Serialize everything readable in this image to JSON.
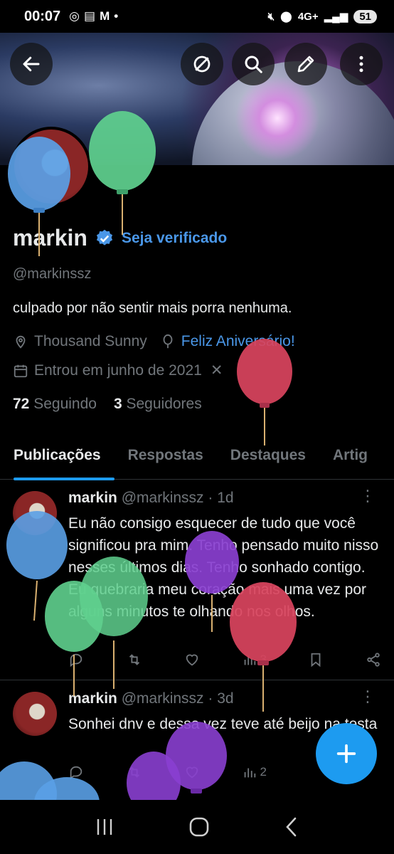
{
  "status_bar": {
    "time": "00:07",
    "network": "4G+",
    "battery": "51"
  },
  "header": {
    "back_icon": "arrow-left-icon",
    "grok_icon": "grok-icon",
    "search_icon": "search-icon",
    "edit_icon": "pencil-icon",
    "more_icon": "more-vertical-icon"
  },
  "profile": {
    "name": "markin",
    "verify_link": "Seja verificado",
    "handle": "@markinssz",
    "bio": "culpado por não sentir mais porra nenhuma.",
    "location": "Thousand Sunny",
    "birthday": "Feliz Aniversário!",
    "joined": "Entrou em junho de 2021",
    "following_count": "72",
    "following_label": "Seguindo",
    "followers_count": "3",
    "followers_label": "Seguidores"
  },
  "tabs": [
    {
      "label": "Publicações",
      "active": true
    },
    {
      "label": "Respostas",
      "active": false
    },
    {
      "label": "Destaques",
      "active": false
    },
    {
      "label": "Artig",
      "active": false
    }
  ],
  "posts": [
    {
      "name": "markin",
      "handle": "@markinssz",
      "time": "· 1d",
      "text": "Eu não consigo esquecer de tudo que você significou pra mim. Tenho pensado muito nisso nesses últimos dias. Tenho sonhado contigo. Eu quebraria meu coração mais uma vez por alguns minutos te olhando nos olhos.",
      "views": "3"
    },
    {
      "name": "markin",
      "handle": "@markinssz",
      "time": "· 3d",
      "text": "Sonhei dnv e dessa vez teve até beijo na testa",
      "views": "2"
    }
  ],
  "colors": {
    "accent": "#1d9bf0",
    "link": "#4a97e8",
    "muted": "#71767b",
    "balloon_blue": "#5aa0e6",
    "balloon_green": "#5fd08e",
    "balloon_red": "#d8445e",
    "balloon_purple": "#8a3fd0"
  }
}
